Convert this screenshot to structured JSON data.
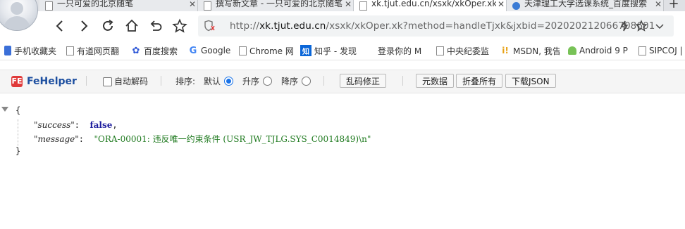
{
  "tabs": [
    {
      "title": "一只可爱的北京随笔",
      "icon": "doc-icon"
    },
    {
      "title": "撰写新文章 - 一只可爱的北京随笔",
      "icon": "doc-icon"
    },
    {
      "title": "xk.tjut.edu.cn/xsxk/xkOper.xk",
      "icon": "doc-icon"
    },
    {
      "title": "天津理工大学选课系统_百度搜索",
      "icon": "globe-icon"
    }
  ],
  "toolbar": {
    "url_prefix": "http://",
    "url_host": "xk.tjut.edu.cn",
    "url_path": "/xsxk/xkOper.xk?method=handleTjxk&jxbid=202020212066708601"
  },
  "bookmarks": [
    {
      "label": "手机收藏夹",
      "icon": "phone-icon",
      "color": "#3b6fd8"
    },
    {
      "label": "有道网页翻",
      "icon": "doc-icon",
      "color": "#888888"
    },
    {
      "label": "百度搜索",
      "icon": "paw-icon",
      "color": "#2b55d6"
    },
    {
      "label": "Google",
      "icon": "google-icon",
      "color": "#4285f4"
    },
    {
      "label": "Chrome 网",
      "icon": "doc-icon",
      "color": "#888888"
    },
    {
      "label": "知乎 - 发现",
      "icon": "zhihu-icon",
      "color": "#0a66d8"
    },
    {
      "label": "登录你的 M",
      "icon": "windows-icon",
      "color": "#f25022"
    },
    {
      "label": "中央纪委监",
      "icon": "doc-icon",
      "color": "#888888"
    },
    {
      "label": "MSDN, 我告",
      "icon": "msdn-icon",
      "color": "#e8a317"
    },
    {
      "label": "Android 9 P",
      "icon": "android-icon",
      "color": "#78c257"
    },
    {
      "label": "SIPCOJ | R",
      "icon": "doc-icon",
      "color": "#888888"
    }
  ],
  "fehelper": {
    "title": "FeHelper",
    "auto_decode": "自动解码",
    "sort_label": "排序:",
    "sort_default": "默认",
    "sort_asc": "升序",
    "sort_desc": "降序",
    "fix_btn": "乱码修正",
    "raw_btn": "元数据",
    "fold_btn": "折叠所有",
    "download_btn": "下载JSON"
  },
  "json": {
    "open": "{",
    "close": "}",
    "rows": [
      {
        "key": "\"success\"",
        "value": "false",
        "type": "bool",
        "comma": ","
      },
      {
        "key": "\"message\"",
        "value": "\"ORA-00001: 违反唯一约束条件 (USR_JW_TJLG.SYS_C0014849)\\n\"",
        "type": "string",
        "comma": ""
      }
    ]
  }
}
